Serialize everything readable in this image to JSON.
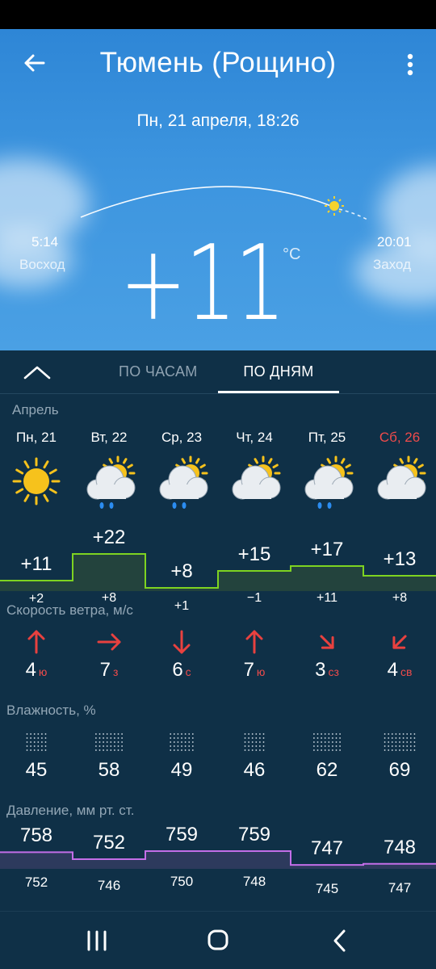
{
  "header": {
    "title": "Тюмень (Рощино)",
    "datetime": "Пн, 21 апреля, 18:26",
    "back_icon": "arrow-left-icon",
    "menu_icon": "more-vert-icon"
  },
  "sun": {
    "sunrise_time": "5:14",
    "sunrise_label": "Восход",
    "sunset_time": "20:01",
    "sunset_label": "Заход"
  },
  "current": {
    "temp": "+11",
    "unit": "°C"
  },
  "tabs": {
    "hourly": "ПО ЧАСАМ",
    "daily": "ПО ДНЯМ",
    "active": "daily"
  },
  "month": "Апрель",
  "days": [
    {
      "name": "Пн, 21",
      "weekend": false,
      "icon": "sun-icon",
      "tmax": "+11",
      "tmin": "+2",
      "wind": "4",
      "wind_dir": "ю",
      "humidity": "45",
      "p_max": "758",
      "p_min": "752"
    },
    {
      "name": "Вт, 22",
      "weekend": false,
      "icon": "partly-cloudy-rain-icon",
      "tmax": "+22",
      "tmin": "+8",
      "wind": "7",
      "wind_dir": "з",
      "humidity": "58",
      "p_max": "752",
      "p_min": "746"
    },
    {
      "name": "Ср, 23",
      "weekend": false,
      "icon": "partly-cloudy-rain-icon",
      "tmax": "+8",
      "tmin": "+1",
      "wind": "6",
      "wind_dir": "с",
      "humidity": "49",
      "p_max": "759",
      "p_min": "750"
    },
    {
      "name": "Чт, 24",
      "weekend": false,
      "icon": "partly-cloudy-icon",
      "tmax": "+15",
      "tmin": "−1",
      "wind": "7",
      "wind_dir": "ю",
      "humidity": "46",
      "p_max": "759",
      "p_min": "748"
    },
    {
      "name": "Пт, 25",
      "weekend": false,
      "icon": "partly-cloudy-rain-icon",
      "tmax": "+17",
      "tmin": "+11",
      "wind": "3",
      "wind_dir": "сз",
      "humidity": "62",
      "p_max": "747",
      "p_min": "745"
    },
    {
      "name": "Сб, 26",
      "weekend": true,
      "icon": "partly-cloudy-icon",
      "tmax": "+13",
      "tmin": "+8",
      "wind": "4",
      "wind_dir": "св",
      "humidity": "69",
      "p_max": "748",
      "p_min": "747"
    }
  ],
  "sections": {
    "wind": "Скорость ветра, м/с",
    "humidity": "Влажность, %",
    "pressure": "Давление, мм рт. ст."
  },
  "colors": {
    "accent_red": "#ef4b4b",
    "temp_line": "#7ed321",
    "temp_line_hot": "#e6c84a",
    "pressure_line": "#c36ee8",
    "panel_bg": "#0f3047"
  },
  "navbar": {
    "recent_icon": "recent-apps-icon",
    "home_icon": "home-icon",
    "back_icon": "back-chevron-icon"
  }
}
